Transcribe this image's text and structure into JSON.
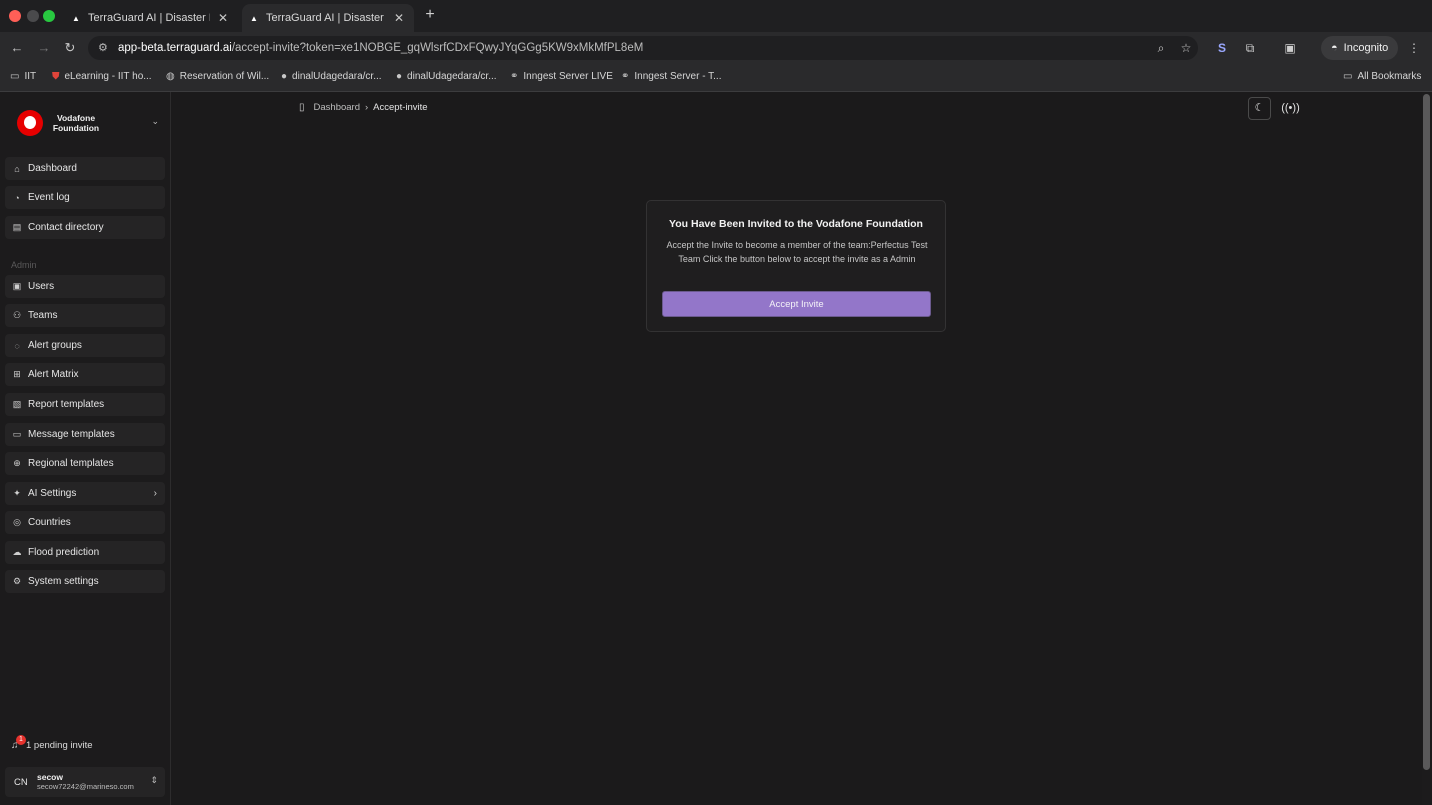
{
  "browser": {
    "tabs": [
      {
        "title": "TerraGuard AI | Disaster Risk",
        "active": false
      },
      {
        "title": "TerraGuard AI | Disaster Risk",
        "active": true
      }
    ],
    "url_host": "app-beta.terraguard.ai",
    "url_rest": "/accept-invite?token=xe1NOBGE_gqWlsrfCDxFQwyJYqGGg5KW9xMkMfPL8eM",
    "incognito_label": "Incognito",
    "bookmarks": [
      {
        "label": "IIT",
        "icon": "folder-icon"
      },
      {
        "label": "eLearning - IIT ho...",
        "icon": "shield-icon"
      },
      {
        "label": "Reservation of Wil...",
        "icon": "globe-icon"
      },
      {
        "label": "dinalUdagedara/cr...",
        "icon": "github-icon"
      },
      {
        "label": "dinalUdagedara/cr...",
        "icon": "github-icon"
      },
      {
        "label": "Inngest Server LIVE",
        "icon": "link-icon"
      },
      {
        "label": "Inngest Server - T...",
        "icon": "link-icon"
      }
    ],
    "all_bookmarks_label": "All Bookmarks"
  },
  "sidebar": {
    "org_name": "Vodafone Foundation",
    "nav": [
      {
        "label": "Dashboard",
        "icon": "home-icon"
      },
      {
        "label": "Event log",
        "icon": "activity-icon"
      },
      {
        "label": "Contact directory",
        "icon": "contacts-icon"
      }
    ],
    "admin_label": "Admin",
    "admin_nav": [
      {
        "label": "Users",
        "icon": "user-icon"
      },
      {
        "label": "Teams",
        "icon": "teams-icon"
      },
      {
        "label": "Alert groups",
        "icon": "alert-icon"
      },
      {
        "label": "Alert Matrix",
        "icon": "grid-icon"
      },
      {
        "label": "Report templates",
        "icon": "report-icon"
      },
      {
        "label": "Message templates",
        "icon": "message-icon"
      },
      {
        "label": "Regional templates",
        "icon": "globe-icon"
      },
      {
        "label": "AI Settings",
        "icon": "sparkles-icon"
      },
      {
        "label": "Countries",
        "icon": "earth-icon"
      },
      {
        "label": "Flood prediction",
        "icon": "cloud-icon"
      },
      {
        "label": "System settings",
        "icon": "gear-icon"
      }
    ],
    "pending_count": "1",
    "pending_label": "1 pending invite",
    "user": {
      "initials": "CN",
      "name": "secow",
      "email": "secow72242@marineso.com"
    }
  },
  "main": {
    "breadcrumb": [
      "Dashboard",
      "Accept-invite"
    ],
    "invite": {
      "title": "You Have Been Invited to the Vodafone Foundation",
      "description": "Accept the Invite to become a member of the team:Perfectus Test Team Click the button below to accept the invite as a Admin",
      "button_label": "Accept Invite"
    }
  },
  "colors": {
    "accent": "#9376c9",
    "brand_red": "#e60000"
  }
}
